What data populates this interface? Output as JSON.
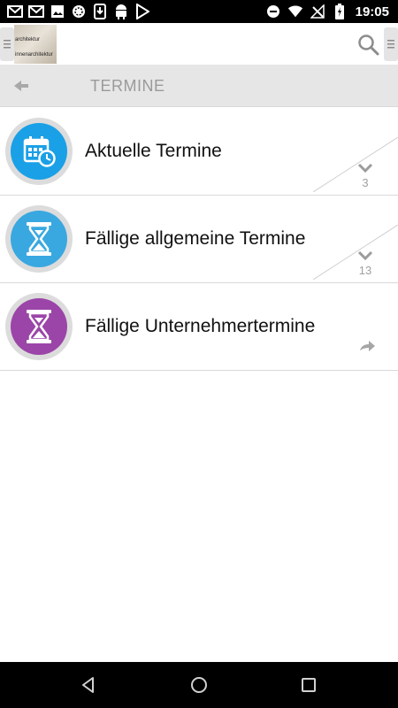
{
  "status_bar": {
    "time": "19:05",
    "left_icons": [
      "gmail-icon",
      "gmail-icon",
      "image-icon",
      "sync-icon",
      "download-icon",
      "android-icon",
      "play-store-icon"
    ],
    "right_icons": [
      "do-not-disturb-icon",
      "wifi-icon",
      "no-signal-icon",
      "battery-charging-icon"
    ]
  },
  "header": {
    "logo_lines": [
      "architektur",
      "innenarchitektur"
    ],
    "search_icon": "search-icon",
    "left_handle_icon": "menu-icon",
    "right_handle_icon": "menu-icon"
  },
  "title_bar": {
    "back_icon": "back-arrow-icon",
    "title": "TERMINE"
  },
  "list": {
    "items": [
      {
        "label": "Aktuelle Termine",
        "icon": "calendar-clock-icon",
        "color": "#1aa0e6",
        "count": "3",
        "indicator": "chevron-down-icon"
      },
      {
        "label": "Fällige allgemeine Termine",
        "icon": "hourglass-icon",
        "color": "#3aa8e0",
        "count": "13",
        "indicator": "chevron-down-icon"
      },
      {
        "label": "Fällige Unternehmertermine",
        "icon": "hourglass-icon",
        "color": "#9b45a8",
        "count": "",
        "indicator": "share-arrow-icon"
      }
    ]
  },
  "nav_bar": {
    "back": "nav-back-icon",
    "home": "nav-home-icon",
    "recents": "nav-recents-icon"
  }
}
